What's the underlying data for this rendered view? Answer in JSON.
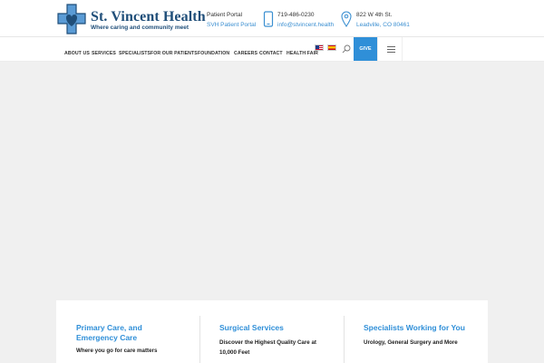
{
  "brand": {
    "name": "St. Vincent Health",
    "tagline": "Where caring and community meet",
    "logo_color": "#1f4e79",
    "accent_color": "#2f8fd8"
  },
  "header": {
    "portal": {
      "label": "Patient Portal",
      "link": "SVH Patient Portal"
    },
    "phone": {
      "number": "719-486-0230",
      "email": "info@stvincent.health",
      "icon": "phone-icon"
    },
    "address": {
      "street": "822 W 4th St.",
      "city": "Leadville, CO 80461",
      "icon": "map-pin-icon"
    }
  },
  "nav": {
    "items": [
      "ABOUT US",
      "SERVICES",
      "SPECIALISTS",
      "FOR OUR PATIENTS",
      "FOUNDATION",
      "CAREERS",
      "CONTACT",
      "HEALTH FAIR"
    ],
    "give_label": "GIVE",
    "language_flags": [
      "us-flag-icon",
      "spain-flag-icon"
    ],
    "search_icon": "search-icon",
    "menu_icon": "hamburger-icon"
  },
  "cards": [
    {
      "title": "Primary Care, and Emergency Care",
      "description": "Where you go for care matters"
    },
    {
      "title": "Surgical Services",
      "description": "Discover the Highest Quality Care at 10,000 Feet"
    },
    {
      "title": "Specialists Working for You",
      "description": "Urology, General Surgery and More"
    }
  ]
}
